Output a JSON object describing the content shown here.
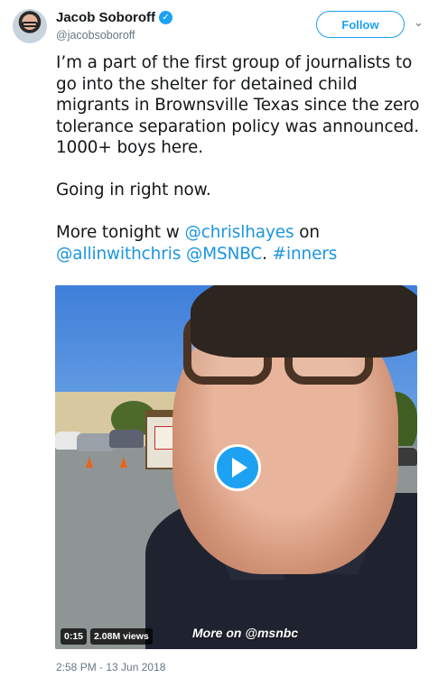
{
  "author": {
    "name": "Jacob Soboroff",
    "handle": "@jacobsoboroff",
    "verified_glyph": "✓"
  },
  "follow_button": {
    "label": "Follow"
  },
  "menu_caret": {
    "glyph": "⌄"
  },
  "tweet": {
    "p1": "I’m a part of the first group of journalists to go into the shelter for detained child migrants in Brownsville Texas since the zero tolerance separation policy was announced. 1000+ boys here.",
    "p2": "Going in right now.",
    "p3_prefix": "More tonight w ",
    "mention1": "@chrislhayes",
    "p3_mid": " on ",
    "mention2": "@allinwithchris",
    "space": " ",
    "mention3": "@MSNBC",
    "p3_dot": ". ",
    "hashtag": "#inners"
  },
  "video": {
    "duration": "0:15",
    "views": "2.08M views",
    "more_on": "More on @msnbc"
  },
  "timestamp": "2:58 PM - 13 Jun 2018",
  "colors": {
    "link": "#1b95e0",
    "follow_border": "#1da1f2",
    "play_button": "#1da1f2",
    "meta_gray": "#657786"
  }
}
